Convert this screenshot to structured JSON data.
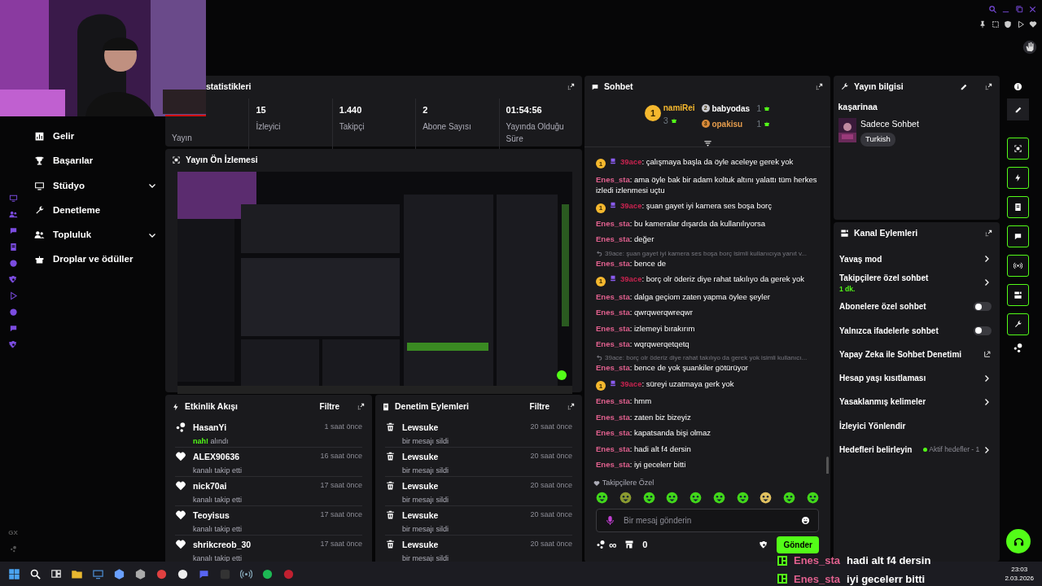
{
  "browser_sidebar": {
    "logo": "GX"
  },
  "sidebar": {
    "items": [
      {
        "kind": "chart",
        "label": "Gelir",
        "expandable": false
      },
      {
        "kind": "trophy",
        "label": "Başarılar",
        "expandable": false
      },
      {
        "kind": "studio",
        "label": "Stüdyo",
        "expandable": true
      },
      {
        "kind": "wrench",
        "label": "Denetleme",
        "expandable": false
      },
      {
        "kind": "people",
        "label": "Topluluk",
        "expandable": true
      },
      {
        "kind": "gift",
        "label": "Droplar ve ödüller",
        "expandable": false
      }
    ]
  },
  "stats": {
    "title": "statistikleri",
    "items": [
      {
        "label": "Yayın"
      },
      {
        "value": "15",
        "label": "İzleyici"
      },
      {
        "value": "1.440",
        "label": "Takipçi"
      },
      {
        "value": "2",
        "label": "Abone Sayısı"
      },
      {
        "value": "01:54:56",
        "label": "Yayında Olduğu Süre"
      }
    ]
  },
  "preview": {
    "title": "Yayın Ön İzlemesi",
    "kind": "picture"
  },
  "activity": {
    "title": "Etkinlik Akışı",
    "filter": "Filtre",
    "items": [
      {
        "kind": "drop",
        "user": "HasanYi",
        "reward": "nah!",
        "text": "alındı",
        "time": "1 saat önce"
      },
      {
        "kind": "follow",
        "user": "ALEX90636",
        "text": "kanalı takip etti",
        "time": "16 saat önce"
      },
      {
        "kind": "follow",
        "user": "nick70ai",
        "text": "kanalı takip etti",
        "time": "17 saat önce"
      },
      {
        "kind": "follow",
        "user": "Teoyisus",
        "text": "kanalı takip etti",
        "time": "17 saat önce"
      },
      {
        "kind": "follow",
        "user": "shrikcreob_30",
        "text": "kanalı takip etti",
        "time": "17 saat önce"
      }
    ]
  },
  "mod_actions": {
    "title": "Denetim Eylemleri",
    "filter": "Filtre",
    "items": [
      {
        "user": "Lewsuke",
        "text": "bir mesajı sildi",
        "time": "20 saat önce"
      },
      {
        "user": "Lewsuke",
        "text": "bir mesajı sildi",
        "time": "20 saat önce"
      },
      {
        "user": "Lewsuke",
        "text": "bir mesajı sildi",
        "time": "20 saat önce"
      },
      {
        "user": "Lewsuke",
        "text": "bir mesajı sildi",
        "time": "20 saat önce"
      },
      {
        "user": "Lewsuke",
        "text": "bir mesajı sildi",
        "time": "20 saat önce"
      }
    ]
  },
  "chat": {
    "title": "Sohbet",
    "leaderboard": [
      {
        "rank": "1",
        "user": "namiRei",
        "count": "3"
      },
      {
        "rank": "2",
        "user": "babyodas",
        "count": "1"
      },
      {
        "rank": "3",
        "user": "opakisu",
        "count": "1"
      }
    ],
    "messages": [
      {
        "kind": "badged",
        "rank": "1",
        "user": "39ace",
        "color": "#c8234f",
        "text": "çalışmaya başla da öyle aceleye gerek yok"
      },
      {
        "kind": "plain",
        "user": "Enes_sta",
        "color": "#e0608e",
        "text": "ama öyle bak bir adam koltuk altını yalattı tüm herkes izledi izlenmesi uçtu"
      },
      {
        "kind": "badged",
        "rank": "1",
        "user": "39ace",
        "color": "#c8234f",
        "text": "şuan gayet iyi kamera ses boşa borç"
      },
      {
        "kind": "plain",
        "user": "Enes_sta",
        "color": "#e0608e",
        "text": "bu kameralar dışarda da kullanılıyorsa"
      },
      {
        "kind": "plain",
        "user": "Enes_sta",
        "color": "#e0608e",
        "text": "değer"
      },
      {
        "kind": "plain",
        "user": "Enes_sta",
        "color": "#e0608e",
        "reply": "39ace: şuan gayet iyi kamera ses boşa borç isimli kullanıcıya yanıt v...",
        "text": "bence de"
      },
      {
        "kind": "badged",
        "rank": "1",
        "user": "39ace",
        "color": "#c8234f",
        "text": "borç olr öderiz diye rahat takılıyo da gerek yok"
      },
      {
        "kind": "plain",
        "user": "Enes_sta",
        "color": "#e0608e",
        "text": "dalga geçiom zaten yapma öylee şeyler"
      },
      {
        "kind": "plain",
        "user": "Enes_sta",
        "color": "#e0608e",
        "text": "qwrqwerqwreqwr"
      },
      {
        "kind": "plain",
        "user": "Enes_sta",
        "color": "#e0608e",
        "text": "izlemeyi bırakırım"
      },
      {
        "kind": "plain",
        "user": "Enes_sta",
        "color": "#e0608e",
        "text": "wqrqwerqetqetq"
      },
      {
        "kind": "plain",
        "user": "Enes_sta",
        "color": "#e0608e",
        "reply": "39ace: borç olr öderiz diye rahat takılıyo da gerek yok isimli kullanıcı...",
        "text": "bence de yok şuankiler götürüyor"
      },
      {
        "kind": "badged",
        "rank": "1",
        "user": "39ace",
        "color": "#c8234f",
        "text": "süreyi uzatmaya gerk yok"
      },
      {
        "kind": "plain",
        "user": "Enes_sta",
        "color": "#e0608e",
        "text": "hmm"
      },
      {
        "kind": "plain",
        "user": "Enes_sta",
        "color": "#e0608e",
        "text": "zaten biz bizeyiz"
      },
      {
        "kind": "plain",
        "user": "Enes_sta",
        "color": "#e0608e",
        "text": "kapatsanda bişi olmaz"
      },
      {
        "kind": "plain",
        "user": "Enes_sta",
        "color": "#e0608e",
        "text": "hadi alt f4 dersin"
      },
      {
        "kind": "plain",
        "user": "Enes_sta",
        "color": "#e0608e",
        "text": "iyi gecelerr bitti"
      }
    ],
    "separator": ":",
    "emote_section": "Takipçilere Özel",
    "input": {
      "placeholder": "Bir mesaj gönderin"
    },
    "points": "∞",
    "store_count": "0",
    "send": "Gönder"
  },
  "stream_info": {
    "title": "Yayın bilgisi",
    "channel": "kaşarinaa",
    "category": "Sadece Sohbet",
    "tags": [
      "Turkish"
    ]
  },
  "channel_actions": {
    "title": "Kanal Eylemleri",
    "items": [
      {
        "kind": "chevron",
        "label": "Yavaş mod"
      },
      {
        "kind": "chevron",
        "label": "Takipçilere özel sohbet",
        "sub": "1 dk."
      },
      {
        "kind": "toggle",
        "label": "Abonelere özel sohbet",
        "on": false
      },
      {
        "kind": "toggle",
        "label": "Yalnızca ifadelerle sohbet",
        "on": false
      },
      {
        "kind": "external",
        "label": "Yapay Zeka ile Sohbet Denetimi"
      },
      {
        "kind": "chevron",
        "label": "Hesap yaşı kısıtlaması"
      },
      {
        "kind": "chevron",
        "label": "Yasaklanmış kelimeler"
      },
      {
        "kind": "plain",
        "label": "İzleyici Yönlendir"
      },
      {
        "kind": "chevron",
        "label": "Hedefleri belirleyin",
        "status": "Aktif hedefler - 1"
      }
    ]
  },
  "overlay": [
    {
      "user": "Enes_sta",
      "text": "hadi alt f4 dersin"
    },
    {
      "user": "Enes_sta",
      "text": "iyi gecelerr bitti"
    }
  ],
  "taskbar": {
    "time": "23:03",
    "date": "2.03.2026"
  }
}
